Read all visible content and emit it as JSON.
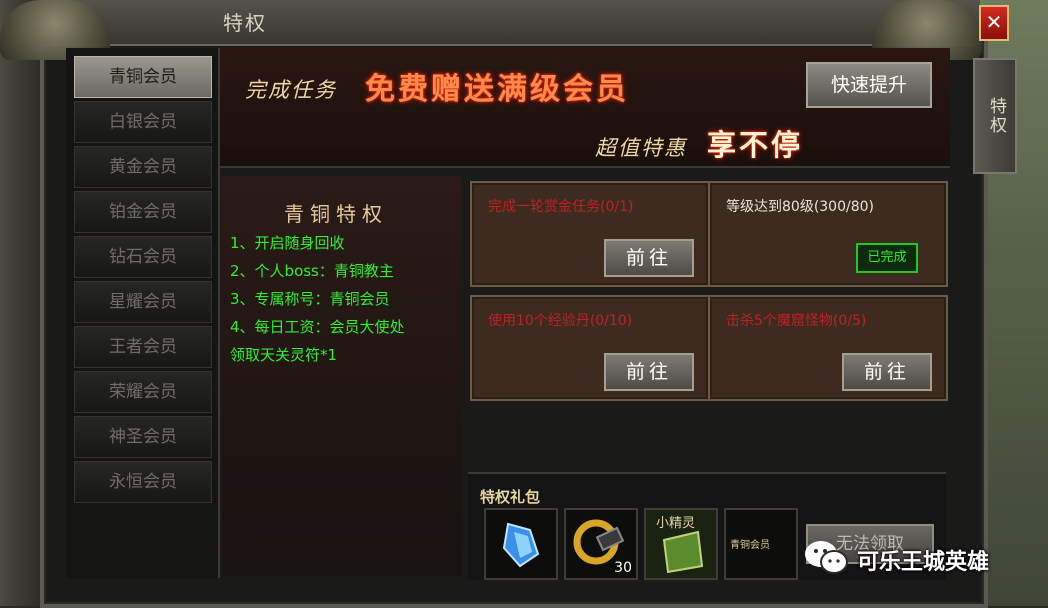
{
  "window": {
    "title": "特权",
    "close_glyph": "✕",
    "side_tab": "特权"
  },
  "tiers": [
    {
      "label": "青铜会员",
      "active": true
    },
    {
      "label": "白银会员",
      "active": false
    },
    {
      "label": "黄金会员",
      "active": false
    },
    {
      "label": "铂金会员",
      "active": false
    },
    {
      "label": "钻石会员",
      "active": false
    },
    {
      "label": "星耀会员",
      "active": false
    },
    {
      "label": "王者会员",
      "active": false
    },
    {
      "label": "荣耀会员",
      "active": false
    },
    {
      "label": "神圣会员",
      "active": false
    },
    {
      "label": "永恒会员",
      "active": false
    }
  ],
  "banner": {
    "line1_prefix": "完成任务",
    "line1_highlight": "免费赠送满级会员",
    "line2_prefix": "超值特惠",
    "line2_highlight": "享不停",
    "quick_upgrade": "快速提升"
  },
  "privileges": {
    "title": "青铜特权",
    "items": [
      "1、开启随身回收",
      "2、个人boss：青铜教主",
      "3、专属称号：青铜会员",
      "4、每日工资：会员大使处",
      "领取天关灵符*1"
    ]
  },
  "tasks": [
    {
      "text": "完成一轮赏金任务(0/1)",
      "status": "incomplete",
      "button": "前往"
    },
    {
      "text": "等级达到80级(300/80)",
      "status": "complete",
      "badge": "已完成"
    },
    {
      "text": "使用10个经验丹(0/10)",
      "status": "incomplete",
      "button": "前往"
    },
    {
      "text": "击杀5个魔窟怪物(0/5)",
      "status": "incomplete",
      "button": "前往"
    }
  ],
  "gift_pack": {
    "label": "特权礼包",
    "items": [
      {
        "icon": "blue-crystal-icon"
      },
      {
        "icon": "gold-ring-icon",
        "count": "30"
      },
      {
        "icon": "green-scroll-icon",
        "caption": "小精灵"
      },
      {
        "icon": "title-badge-icon",
        "caption": "青铜会员"
      }
    ],
    "claim_button": "无法领取"
  },
  "watermark": {
    "text": "可乐王城英雄",
    "icon": "wechat-icon"
  },
  "colors": {
    "privilege_green": "#30f030",
    "task_red": "#c02020",
    "done_green": "#2cee2c"
  }
}
